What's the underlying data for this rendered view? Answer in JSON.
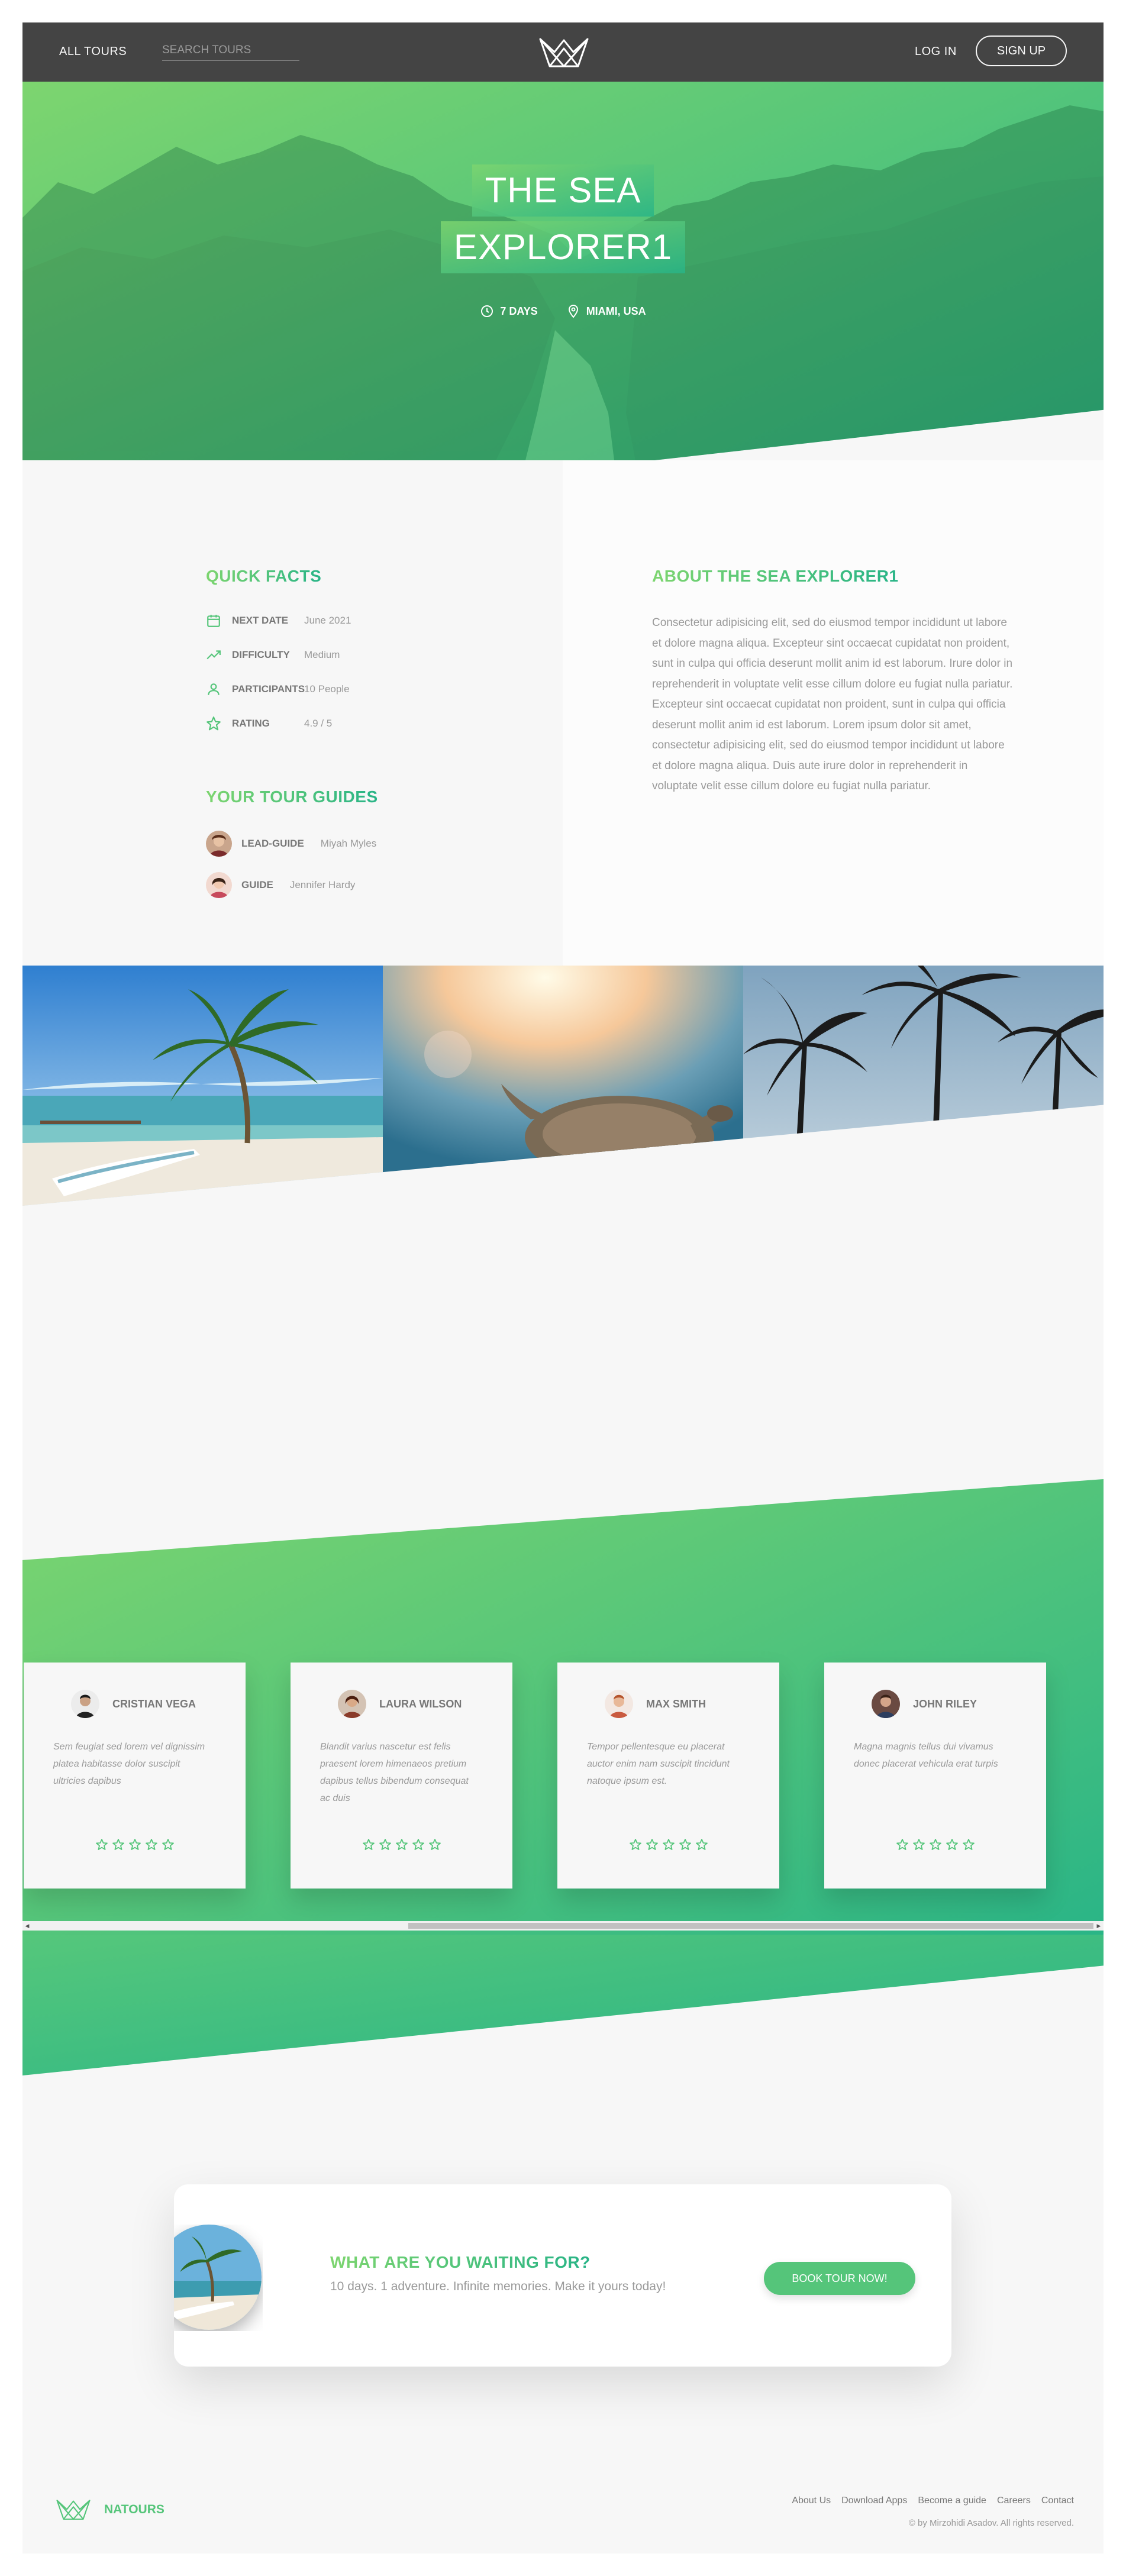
{
  "header": {
    "all_tours": "All tours",
    "search_placeholder": "Search tours",
    "login": "Log in",
    "signup": "Sign up"
  },
  "hero": {
    "title_line1": "THE SEA",
    "title_line2": "EXPLORER1",
    "duration": "7 DAYS",
    "location": "MIAMI, USA"
  },
  "quick_facts": {
    "heading": "Quick facts",
    "items": [
      {
        "label": "Next date",
        "value": "June 2021",
        "icon": "calendar-icon"
      },
      {
        "label": "Difficulty",
        "value": "Medium",
        "icon": "trending-up-icon"
      },
      {
        "label": "Participants",
        "value": "10 People",
        "icon": "user-icon"
      },
      {
        "label": "Rating",
        "value": "4.9 / 5",
        "icon": "star-icon"
      }
    ]
  },
  "guides": {
    "heading": "Your tour guides",
    "items": [
      {
        "role": "Lead-guide",
        "name": "Miyah Myles"
      },
      {
        "role": "Guide",
        "name": "Jennifer Hardy"
      }
    ]
  },
  "about": {
    "heading": "About the sea explorer1",
    "text": "Consectetur adipisicing elit, sed do eiusmod tempor incididunt ut labore et dolore magna aliqua. Excepteur sint occaecat cupidatat non proident, sunt in culpa qui officia deserunt mollit anim id est laborum. Irure dolor in reprehenderit in voluptate velit esse cillum dolore eu fugiat nulla pariatur. Excepteur sint occaecat cupidatat non proident, sunt in culpa qui officia deserunt mollit anim id est laborum. Lorem ipsum dolor sit amet, consectetur adipisicing elit, sed do eiusmod tempor incididunt ut labore et dolore magna aliqua. Duis aute irure dolor in reprehenderit in voluptate velit esse cillum dolore eu fugiat nulla pariatur."
  },
  "reviews": [
    {
      "name": "Cristian Vega",
      "text": "Sem feugiat sed lorem vel dignissim platea habitasse dolor suscipit ultricies dapibus",
      "stars": 5
    },
    {
      "name": "Laura Wilson",
      "text": "Blandit varius nascetur est felis praesent lorem himenaeos pretium dapibus tellus bibendum consequat ac duis",
      "stars": 5
    },
    {
      "name": "Max Smith",
      "text": "Tempor pellentesque eu placerat auctor enim nam suscipit tincidunt natoque ipsum est.",
      "stars": 5
    },
    {
      "name": "John Riley",
      "text": "Magna magnis tellus dui vivamus donec placerat vehicula erat turpis",
      "stars": 5
    }
  ],
  "cta": {
    "heading": "What are you waiting for?",
    "text": "10 days. 1 adventure. Infinite memories. Make it yours today!",
    "button": "Book tour now!"
  },
  "footer": {
    "brand": "NATOURS",
    "links": [
      "About Us",
      "Download Apps",
      "Become a guide",
      "Careers",
      "Contact"
    ],
    "copyright": "© by Mirzohidi Asadov. All rights reserved."
  },
  "colors": {
    "green_light": "#7dd56f",
    "green_dark": "#28b487",
    "button_green": "#55c57a",
    "header_bg": "#444444"
  }
}
